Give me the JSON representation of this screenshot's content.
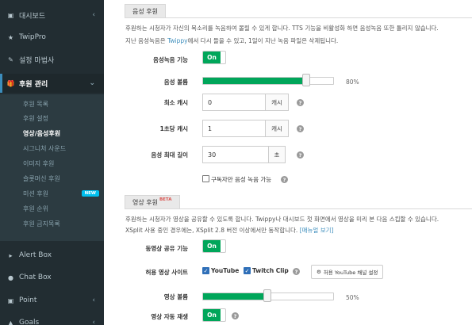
{
  "sidebar": {
    "items": [
      {
        "label": "대시보드",
        "icon": "dashboard-icon"
      },
      {
        "label": "TwipPro",
        "icon": "star-icon"
      },
      {
        "label": "설정 마법사",
        "icon": "magic-wand-icon"
      },
      {
        "label": "후원 관리",
        "icon": "gift-icon"
      },
      {
        "label": "Alert Box",
        "icon": "megaphone-icon"
      },
      {
        "label": "Chat Box",
        "icon": "chat-icon"
      },
      {
        "label": "Point",
        "icon": "point-icon"
      },
      {
        "label": "Goals",
        "icon": "goals-icon"
      }
    ],
    "submenu": [
      "후원 목록",
      "후원 설정",
      "영상/음성후원",
      "시그니처 사운드",
      "이미지 후원",
      "슬롯머신 후원",
      "미션 후원",
      "후원 순위",
      "후원 금지목록"
    ],
    "new_badge": "NEW"
  },
  "voice": {
    "tab": "음성 후원",
    "desc1": "후원하는 시청자가 자신의 목소리를 녹음하여 몰릴 수 있게 합니다. TTS 기능을 비활성화 하면 음성녹음 또한 틀리지 않습니다.",
    "desc2_pre": "지난 음성녹음은 ",
    "desc2_link": "Twippy",
    "desc2_post": "에서 다시 들을 수 있고, 1일이 지난 녹음 파일은 삭제됩니다.",
    "fn_label": "음성녹음 기능",
    "toggle": "On",
    "vol_label": "음성 볼륨",
    "volume": 80,
    "vol_text": "80%",
    "min_cash_label": "최소 캐시",
    "min_cash": "0",
    "per_sec_label": "1초당 캐시",
    "per_sec": "1",
    "cash_unit": "캐시",
    "max_len_label": "음성 최대 길이",
    "max_len": "30",
    "sec_unit": "초",
    "subs_only": "구독자만 음성 녹음 가능",
    "help": "?"
  },
  "video": {
    "tab": "영상 후원",
    "beta": "BETA",
    "desc1": "후원하는 시청자가 영상을 공유할 수 있도록 합니다. Twippy나 대시보드 첫 화면에서 영상을 미리 본 다음 스킵할 수 있습니다.",
    "desc2_pre": "XSplit 사용 중인 경우에는, XSplit 2.8 버전 이상에서만 동작합니다. ",
    "desc2_link": "[매뉴얼 보기]",
    "share_label": "동영상 공유 기능",
    "toggle": "On",
    "sites_label": "허용 영상 사이트",
    "youtube": "YouTube",
    "twitch": "Twitch Clip",
    "channel_btn": "허용 YouTube 채널 설정",
    "vol_label": "영상 볼륨",
    "volume": 50,
    "vol_text": "50%",
    "autoplay_label": "영상 자동 재생",
    "autoplay_toggle": "On"
  },
  "colors": {
    "accent": "#00a65a",
    "sidebar": "#222d32",
    "link": "#3c8dbc",
    "beta": "#d9534f"
  }
}
